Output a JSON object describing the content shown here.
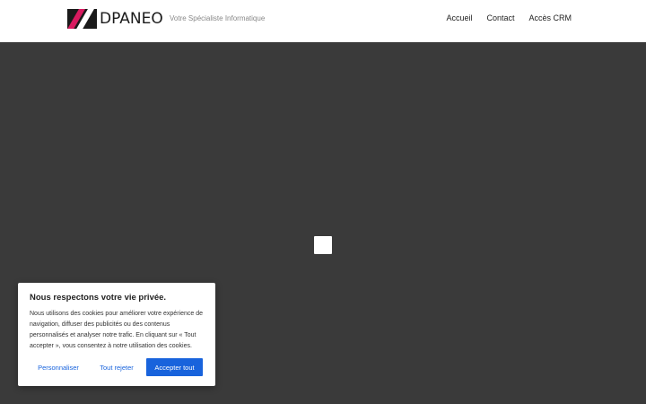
{
  "header": {
    "logo_text": "DPANEO",
    "tagline": "Votre Spécialiste Informatique",
    "nav": {
      "accueil": "Accueil",
      "contact": "Contact",
      "crm": "Accès CRM"
    }
  },
  "cookie_banner": {
    "title": "Nous respectons votre vie privée.",
    "text": "Nous utilisons des cookies pour améliorer votre expérience de navigation, diffuser des publicités ou des contenus personnalisés et analyser notre trafic. En cliquant sur « Tout accepter », vous consentez à notre utilisation des cookies.",
    "customize_label": "Personnaliser",
    "reject_label": "Tout rejeter",
    "accept_label": "Accepter tout"
  },
  "colors": {
    "accent": "#1863dc",
    "brand_magenta": "#d81b60",
    "hero_background": "#3a3a3a"
  }
}
